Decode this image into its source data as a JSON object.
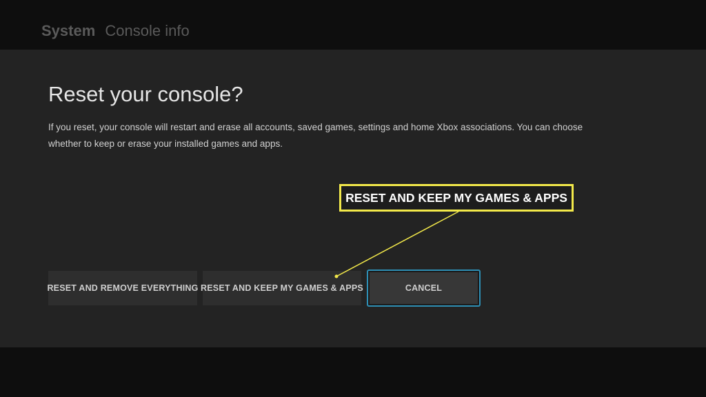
{
  "header": {
    "section": "System",
    "page": "Console info"
  },
  "dialog": {
    "title": "Reset your console?",
    "body": "If you reset, your console will restart and erase all accounts, saved games, settings and home Xbox associations. You can choose whether to keep or erase your installed games and apps.",
    "buttons": {
      "remove_label": "RESET AND REMOVE EVERYTHING",
      "keep_label": "RESET AND KEEP MY GAMES & APPS",
      "cancel_label": "CANCEL"
    }
  },
  "annotation": {
    "callout_text": "RESET AND KEEP MY GAMES & APPS",
    "color": "#f3e94a"
  },
  "colors": {
    "background": "#0e0e0e",
    "dialog": "#232323",
    "focus_border": "#2e8fb5"
  }
}
